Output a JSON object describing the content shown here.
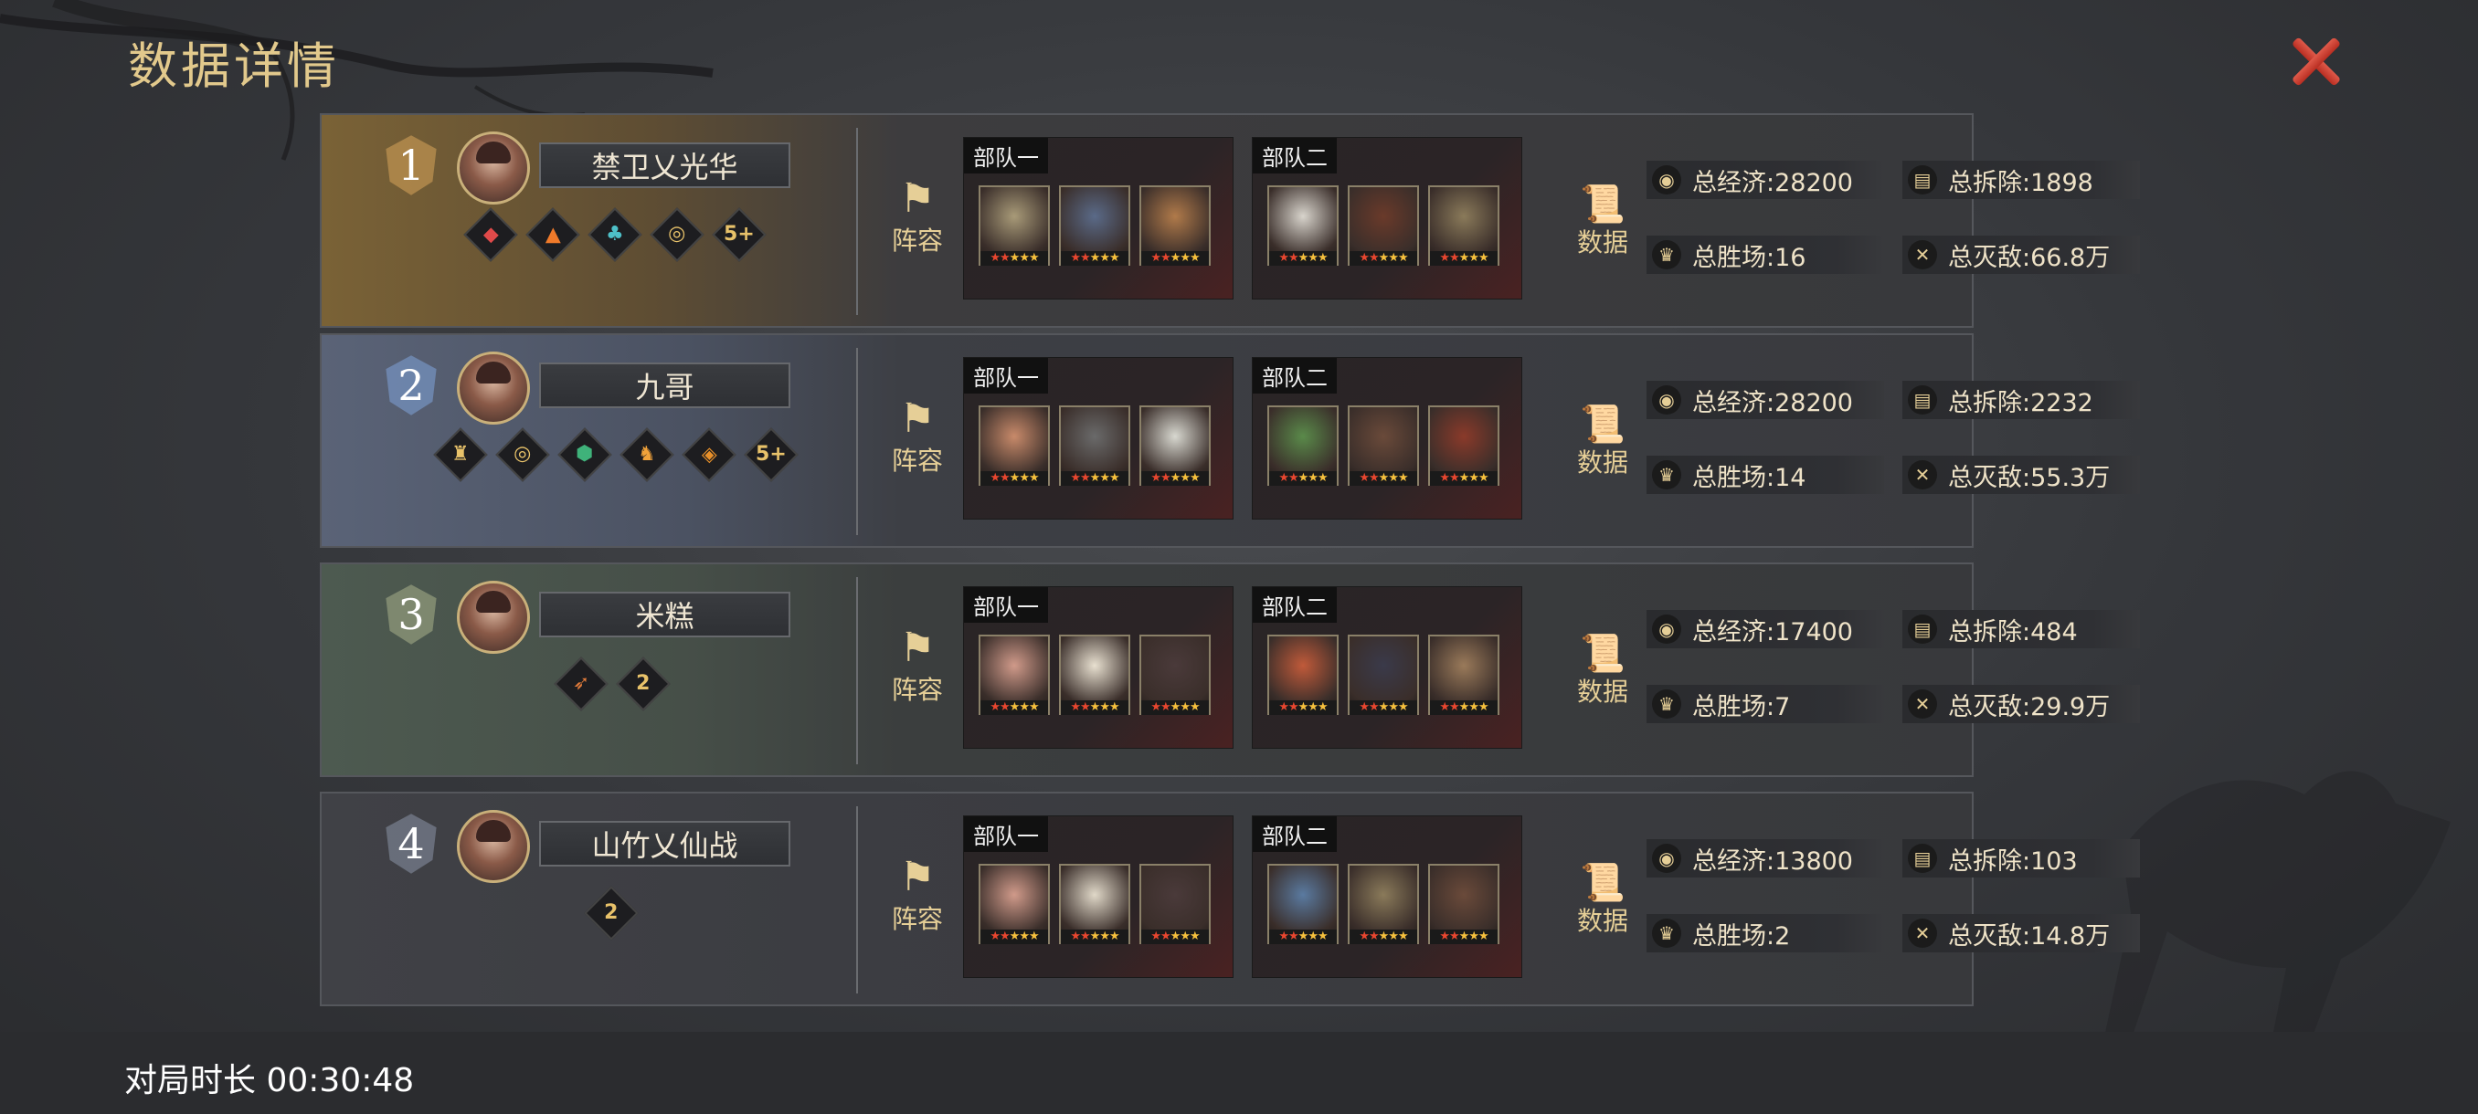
{
  "header": {
    "title": "数据详情",
    "close_icon": "close-x-icon",
    "close_color": "#d24536"
  },
  "labels": {
    "lineup": "阵容",
    "data": "数据",
    "team1": "部队一",
    "team2": "部队二"
  },
  "colors": {
    "gold": "#e2c98c",
    "star": "#f6c03d",
    "star_red": "#e8462f"
  },
  "players": [
    {
      "rank": "1",
      "name": "禁卫乂光华",
      "badges": [
        {
          "icon": "lantern-icon",
          "glyph": "◆",
          "color": "#e04a4a"
        },
        {
          "icon": "fire-icon",
          "glyph": "▲",
          "color": "#f07a2a"
        },
        {
          "icon": "figure-icon",
          "glyph": "♣",
          "color": "#4ec0c8"
        },
        {
          "icon": "coin-icon",
          "glyph": "◎",
          "color": "#e8c26a"
        },
        {
          "icon": "level-badge",
          "glyph": "5+",
          "color": "#e8c26a"
        }
      ],
      "stats": {
        "economy": "总经济:28200",
        "demolish": "总拆除:1898",
        "wins": "总胜场:16",
        "kills": "总灭敌:66.8万"
      }
    },
    {
      "rank": "2",
      "name": "九哥",
      "badges": [
        {
          "icon": "castle-icon",
          "glyph": "♜",
          "color": "#e8c26a"
        },
        {
          "icon": "coin-icon",
          "glyph": "◎",
          "color": "#e8c26a"
        },
        {
          "icon": "shield-icon",
          "glyph": "⬢",
          "color": "#3fb27a"
        },
        {
          "icon": "horse-icon",
          "glyph": "♞",
          "color": "#f0a23a"
        },
        {
          "icon": "shield-stripe-icon",
          "glyph": "◈",
          "color": "#e8902a"
        },
        {
          "icon": "level-badge",
          "glyph": "5+",
          "color": "#e8c26a"
        }
      ],
      "stats": {
        "economy": "总经济:28200",
        "demolish": "总拆除:2232",
        "wins": "总胜场:14",
        "kills": "总灭敌:55.3万"
      }
    },
    {
      "rank": "3",
      "name": "米糕",
      "badges": [
        {
          "icon": "bow-icon",
          "glyph": "➶",
          "color": "#e07a3a"
        },
        {
          "icon": "level-badge",
          "glyph": "2",
          "color": "#e8c26a"
        }
      ],
      "stats": {
        "economy": "总经济:17400",
        "demolish": "总拆除:484",
        "wins": "总胜场:7",
        "kills": "总灭敌:29.9万"
      }
    },
    {
      "rank": "4",
      "name": "山竹乂仙战",
      "badges": [
        {
          "icon": "level-badge",
          "glyph": "2",
          "color": "#e8c26a"
        }
      ],
      "stats": {
        "economy": "总经济:13800",
        "demolish": "总拆除:103",
        "wins": "总胜场:2",
        "kills": "总灭敌:14.8万"
      }
    }
  ],
  "footer": {
    "duration": "对局时长 00:30:48"
  }
}
